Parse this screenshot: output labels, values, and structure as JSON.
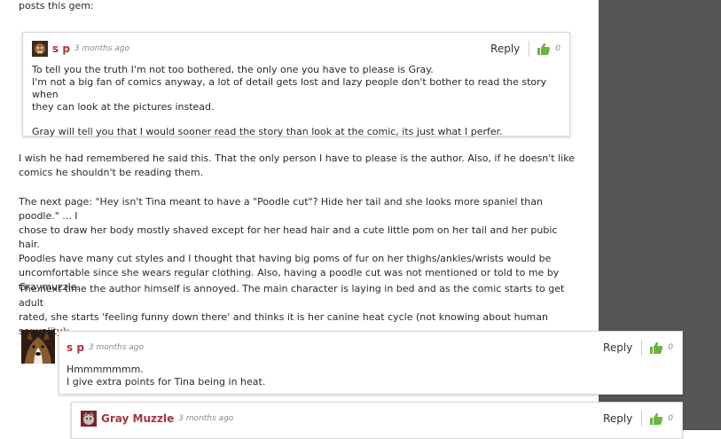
{
  "intro_text": "posts this gem:",
  "comments": [
    {
      "author": "s p",
      "time": "3 months ago",
      "reply_label": "Reply",
      "likes": "0",
      "lines": [
        "To tell you the truth I'm not too bothered, the only one you have to please is Gray.",
        "I'm not a big fan of comics anyway, a lot of detail gets lost and lazy people don't bother to read the story when",
        "they can look at the pictures instead.",
        "Gray will tell you that I would sooner read the story than look at the comic, its just what I perfer."
      ]
    },
    {
      "author": "s p",
      "time": "3 months ago",
      "reply_label": "Reply",
      "likes": "0",
      "lines": [
        "Hmmmmmmm.",
        "I give extra points for Tina being in heat."
      ]
    },
    {
      "author": "Gray Muzzle",
      "time": "3 months ago",
      "reply_label": "Reply",
      "likes": "0"
    }
  ],
  "paragraphs": [
    [
      "I wish he had remembered he said this. That the only person I have to please is the author. Also, if he doesn't like",
      "comics he shouldn't be reading them."
    ],
    [
      "The next page: \"Hey isn't Tina meant to have a \"Poodle cut\"? Hide her tail and she looks more spaniel than poodle.\" ... I",
      "chose to draw her body mostly shaved except for her head hair and a cute little pom on her tail and her pubic hair.",
      "Poodles have many cut styles and I thought that having big poms of fur on her thighs/ankles/wrists would be",
      "uncomfortable since she wears regular clothing. Also, having a poodle cut was not mentioned or told to me by",
      "Graymuzzle."
    ],
    [
      "The next time the author himself is annoyed. The main character is laying in bed and as the comic starts to get adult",
      "rated, she starts 'feeling funny down there' and thinks it is her canine heat cycle (not knowing about human sexuality):"
    ]
  ],
  "colors": {
    "author": "#a8343b",
    "thumb": "#6cb33f",
    "sidebar": "#555555"
  },
  "icons": [
    "avatar-image",
    "thumbs-up-icon"
  ]
}
